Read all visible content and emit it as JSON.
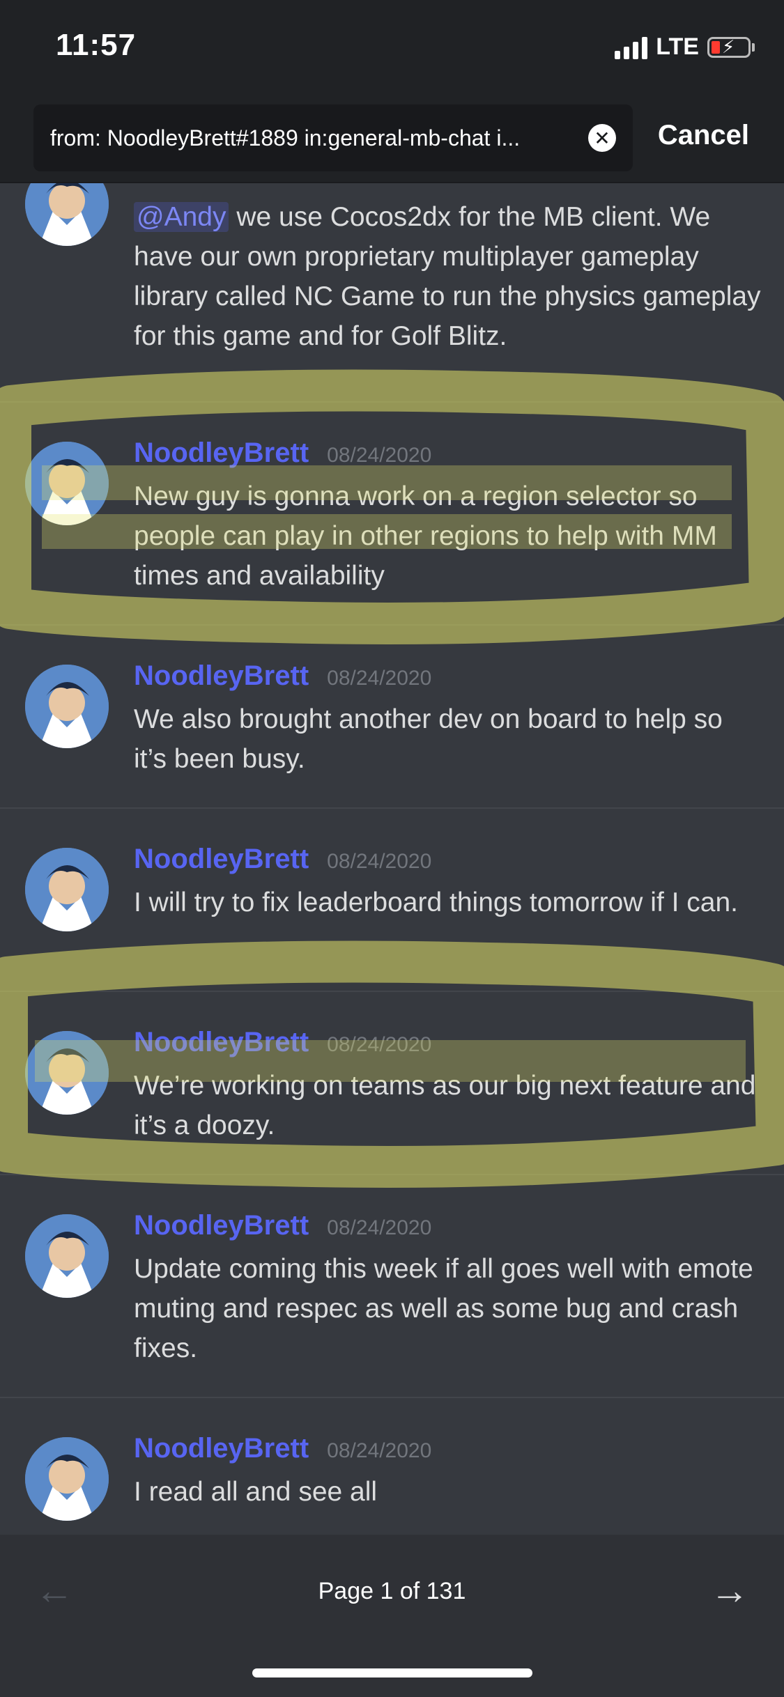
{
  "status": {
    "time": "11:57",
    "network": "LTE"
  },
  "search": {
    "query": "from: NoodleyBrett#1889 in:general-mb-chat i...",
    "cancel_label": "Cancel"
  },
  "messages": [
    {
      "author": "",
      "timestamp": "",
      "mention": "@Andy",
      "text": " we use Cocos2dx for the MB client. We have our own proprietary multiplayer gameplay library called NC Game to run the physics gameplay for this game and for Golf Blitz."
    },
    {
      "author": "NoodleyBrett",
      "timestamp": "08/24/2020",
      "text": "New guy is gonna work on a region selector so people can play in other regions to help with MM times and availability"
    },
    {
      "author": "NoodleyBrett",
      "timestamp": "08/24/2020",
      "text": "We also brought another dev on board to help so it’s been busy."
    },
    {
      "author": "NoodleyBrett",
      "timestamp": "08/24/2020",
      "text": "I will try to fix leaderboard things tomorrow if I can."
    },
    {
      "author": "NoodleyBrett",
      "timestamp": "08/24/2020",
      "text": "We’re working on teams as our big next feature and it’s a doozy."
    },
    {
      "author": "NoodleyBrett",
      "timestamp": "08/24/2020",
      "text": "Update coming this week if all goes well with emote muting and respec as well as some bug and crash fixes."
    },
    {
      "author": "NoodleyBrett",
      "timestamp": "08/24/2020",
      "text": "I read all and see all"
    }
  ],
  "pager": {
    "label": "Page 1 of 131"
  },
  "colors": {
    "author": "#5865f2",
    "highlight": "#e3e36a",
    "background": "#36393f"
  }
}
